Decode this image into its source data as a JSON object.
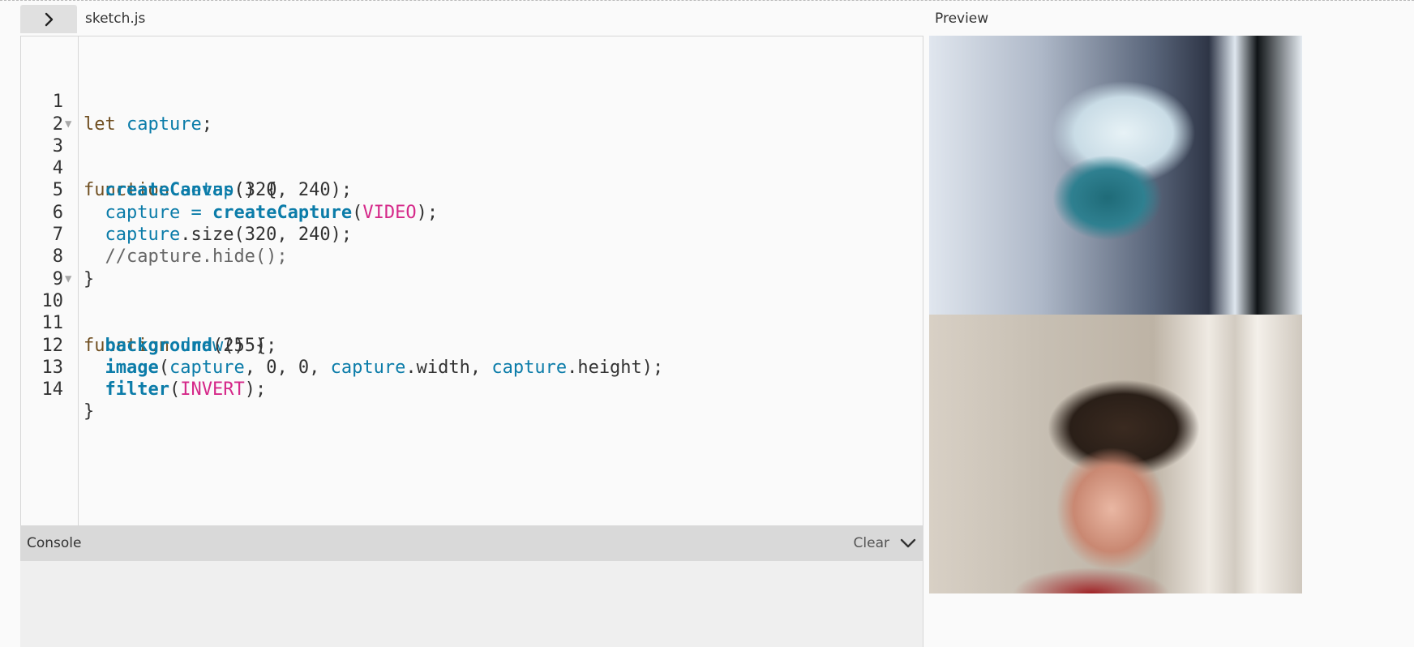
{
  "header": {
    "file_name": "sketch.js",
    "preview_label": "Preview"
  },
  "editor": {
    "line_numbers": [
      "1",
      "2",
      "3",
      "4",
      "5",
      "6",
      "7",
      "8",
      "9",
      "10",
      "11",
      "12",
      "13",
      "14"
    ],
    "foldable_lines": [
      "3",
      "10"
    ]
  },
  "console": {
    "title": "Console",
    "clear_label": "Clear"
  },
  "icons": {
    "expand": "chevron-right-icon",
    "collapse": "chevron-down-icon",
    "fold": "fold-triangle-icon"
  },
  "colors": {
    "keyword": "#704f21",
    "function": "#0b7ca9",
    "constant": "#d52889",
    "comment": "#666666"
  }
}
